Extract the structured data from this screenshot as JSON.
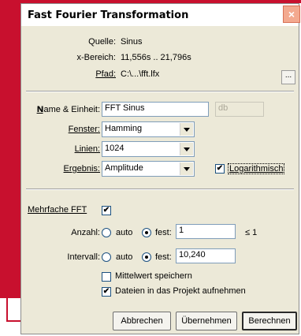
{
  "dialog": {
    "title": "Fast Fourier Transformation",
    "close_label": "×"
  },
  "info": {
    "quelle_label": "Quelle:",
    "quelle_value": "Sinus",
    "xbereich_label": "x-Bereich:",
    "xbereich_value": "11,556s .. 21,796s",
    "pfad_label": "Pfad:",
    "pfad_value": "C:\\...\\fft.lfx",
    "browse_label": "..."
  },
  "settings": {
    "name_label": "Name & Einheit:",
    "name_value": "FFT Sinus",
    "unit_value": "db",
    "fenster_label": "Fenster:",
    "fenster_value": "Hamming",
    "linien_label": "Linien:",
    "linien_value": "1024",
    "ergebnis_label": "Ergebnis:",
    "ergebnis_value": "Amplitude",
    "log_label": "Logarithmisch",
    "log_checked": true
  },
  "multi": {
    "label": "Mehrfache FFT",
    "checked": true,
    "anzahl_label": "Anzahl:",
    "anzahl_auto": "auto",
    "anzahl_fest": "fest:",
    "anzahl_value": "1",
    "anzahl_suffix": "≤ 1",
    "intervall_label": "Intervall:",
    "intervall_auto": "auto",
    "intervall_fest": "fest:",
    "intervall_value": "10,240",
    "mittelwert_label": "Mittelwert speichern",
    "mittelwert_checked": false,
    "projekt_label": "Dateien in das Projekt aufnehmen",
    "projekt_checked": true
  },
  "buttons": {
    "cancel": "Abbrechen",
    "apply": "Übernehmen",
    "compute": "Berechnen"
  }
}
